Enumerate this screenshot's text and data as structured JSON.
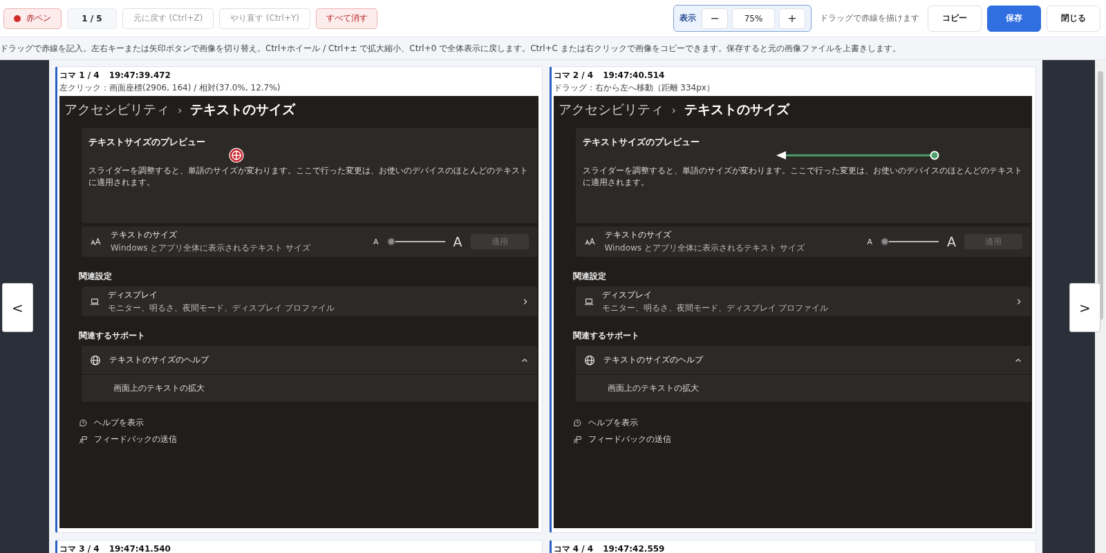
{
  "toolbar": {
    "pen": {
      "label": "赤ペン",
      "selected": true
    },
    "page_counter": "1 / 5",
    "undo": {
      "label": "元に戻す (Ctrl+Z)",
      "disabled": true
    },
    "redo": {
      "label": "やり直す (Ctrl+Y)",
      "disabled": true
    },
    "clear": {
      "label": "すべて消す"
    },
    "zoom": {
      "label": "表示",
      "minus": "−",
      "value": "75%",
      "plus": "+"
    },
    "hint": "ドラッグで赤線を描けます",
    "buttons": [
      {
        "label": "コピー",
        "kind": "default"
      },
      {
        "label": "保存",
        "kind": "primary"
      },
      {
        "label": "閉じる",
        "kind": "default"
      }
    ]
  },
  "help_text": "ドラッグで赤線を記入。左右キーまたは矢印ボタンで画像を切り替え。Ctrl+ホイール / Ctrl+± で拡大縮小、Ctrl+0 で全体表示に戻します。Ctrl+C または右クリックで画像をコピーできます。保存すると元の画像ファイルを上書きします。",
  "nav": {
    "prev": "<",
    "next": ">"
  },
  "frames": [
    {
      "title": "コマ 1 / 4",
      "time": "19:47:39.472",
      "detail": "左クリック：画面座標(2906, 164) / 相対(37.0%, 12.7%)",
      "annotation": {
        "kind": "click"
      },
      "screenshot": {
        "breadcrumb": "アクセシビリティ",
        "separator": "›",
        "page_title": "テキストのサイズ",
        "preview": {
          "title": "テキストサイズのプレビュー",
          "text": "スライダーを調整すると、単語のサイズが変わります。ここで行った変更は、お使いのデバイスのほとんどのテキストに適用されます。"
        },
        "text_size": {
          "title": "テキストのサイズ",
          "subtitle": "Windows とアプリ全体に表示されるテキスト サイズ",
          "small_label": "A",
          "large_label": "A",
          "level": 0,
          "apply": {
            "label": "適用",
            "disabled": true
          }
        },
        "related_heading": "関連設定",
        "display": {
          "title": "ディスプレイ",
          "subtitle": "モニター、明るさ、夜間モード、ディスプレイ プロファイル"
        },
        "support_heading": "関連するサポート",
        "help": {
          "title": "テキストのサイズのヘルプ",
          "expanded": true,
          "children": [
            "画面上のテキストの拡大"
          ]
        },
        "links": [
          {
            "label": "ヘルプを表示",
            "kind": "help"
          },
          {
            "label": "フィードバックの送信",
            "kind": "feedback"
          }
        ]
      }
    },
    {
      "title": "コマ 2 / 4",
      "time": "19:47:40.514",
      "detail": "ドラッグ：右から左へ移動（距離 334px）",
      "annotation": {
        "kind": "drag"
      },
      "screenshot": {
        "breadcrumb": "アクセシビリティ",
        "separator": "›",
        "page_title": "テキストのサイズ",
        "preview": {
          "title": "テキストサイズのプレビュー",
          "text": "スライダーを調整すると、単語のサイズが変わります。ここで行った変更は、お使いのデバイスのほとんどのテキストに適用されます。"
        },
        "text_size": {
          "title": "テキストのサイズ",
          "subtitle": "Windows とアプリ全体に表示されるテキスト サイズ",
          "small_label": "A",
          "large_label": "A",
          "level": 0,
          "apply": {
            "label": "適用",
            "disabled": true
          }
        },
        "related_heading": "関連設定",
        "display": {
          "title": "ディスプレイ",
          "subtitle": "モニター、明るさ、夜間モード、ディスプレイ プロファイル"
        },
        "support_heading": "関連するサポート",
        "help": {
          "title": "テキストのサイズのヘルプ",
          "expanded": true,
          "children": [
            "画面上のテキストの拡大"
          ]
        },
        "links": [
          {
            "label": "ヘルプを表示",
            "kind": "help"
          },
          {
            "label": "フィードバックの送信",
            "kind": "feedback"
          }
        ]
      }
    },
    {
      "title": "コマ 3 / 4",
      "time": "19:47:41.540"
    },
    {
      "title": "コマ 4 / 4",
      "time": "19:47:42.559"
    }
  ]
}
